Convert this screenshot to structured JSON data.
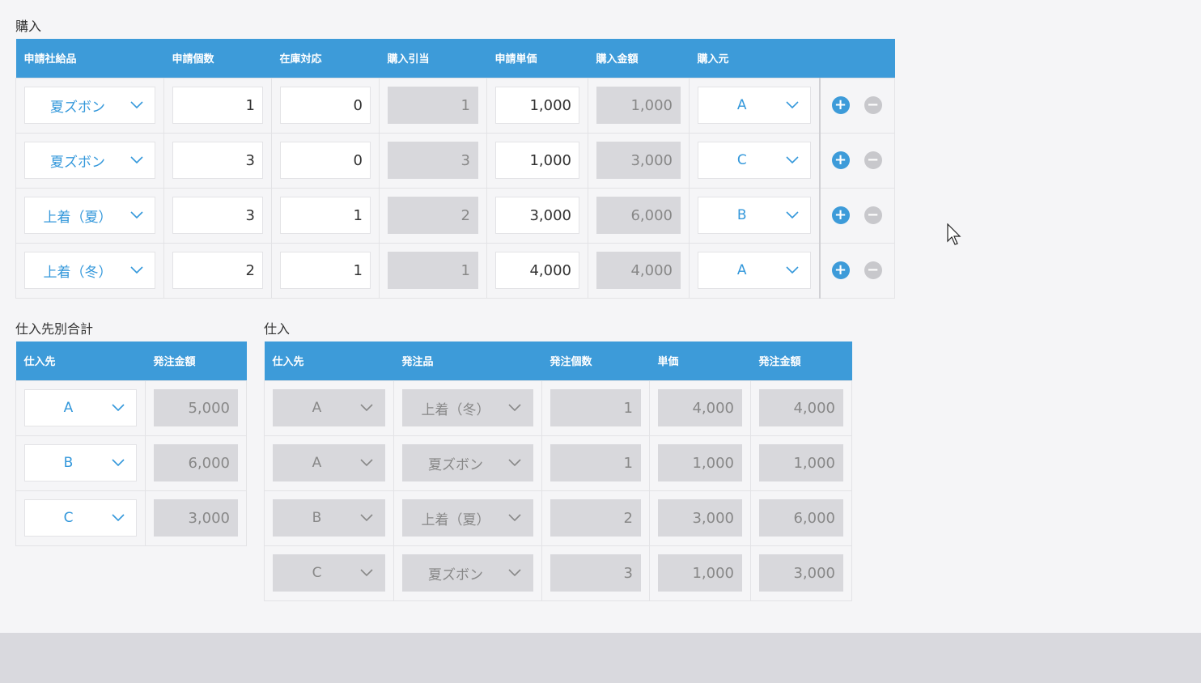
{
  "purchase": {
    "title": "購入",
    "headers": [
      "申請社給品",
      "申請個数",
      "在庫対応",
      "購入引当",
      "申請単価",
      "購入金額",
      "購入元",
      ""
    ],
    "rows": [
      {
        "item": "夏ズボン",
        "qty": "1",
        "stock": "0",
        "alloc": "1",
        "price": "1,000",
        "amount": "1,000",
        "vendor": "A"
      },
      {
        "item": "夏ズボン",
        "qty": "3",
        "stock": "0",
        "alloc": "3",
        "price": "1,000",
        "amount": "3,000",
        "vendor": "C"
      },
      {
        "item": "上着（夏）",
        "qty": "3",
        "stock": "1",
        "alloc": "2",
        "price": "3,000",
        "amount": "6,000",
        "vendor": "B"
      },
      {
        "item": "上着（冬）",
        "qty": "2",
        "stock": "1",
        "alloc": "1",
        "price": "4,000",
        "amount": "4,000",
        "vendor": "A"
      }
    ],
    "add_symbol": "+",
    "remove_symbol": "−"
  },
  "vendor_totals": {
    "title": "仕入先別合計",
    "headers": [
      "仕入先",
      "発注金額"
    ],
    "rows": [
      {
        "vendor": "A",
        "amount": "5,000"
      },
      {
        "vendor": "B",
        "amount": "6,000"
      },
      {
        "vendor": "C",
        "amount": "3,000"
      }
    ]
  },
  "orders": {
    "title": "仕入",
    "headers": [
      "仕入先",
      "発注品",
      "発注個数",
      "単価",
      "発注金額"
    ],
    "rows": [
      {
        "vendor": "A",
        "item": "上着（冬）",
        "qty": "1",
        "price": "4,000",
        "amount": "4,000"
      },
      {
        "vendor": "A",
        "item": "夏ズボン",
        "qty": "1",
        "price": "1,000",
        "amount": "1,000"
      },
      {
        "vendor": "B",
        "item": "上着（夏）",
        "qty": "2",
        "price": "3,000",
        "amount": "6,000"
      },
      {
        "vendor": "C",
        "item": "夏ズボン",
        "qty": "3",
        "price": "1,000",
        "amount": "3,000"
      }
    ]
  },
  "colors": {
    "accent": "#3d9bd9",
    "readonly": "#d8d8dc",
    "select_text": "#3498db"
  },
  "icons": {
    "dropdown": "chevron-down-icon",
    "add": "plus-circle-icon",
    "remove": "minus-circle-icon",
    "cursor": "mouse-pointer-icon"
  }
}
